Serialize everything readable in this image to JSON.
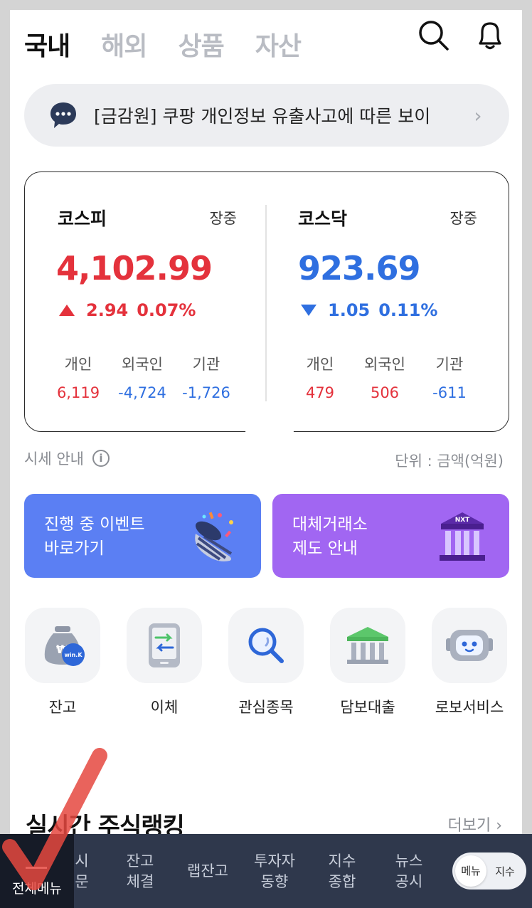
{
  "top_tabs": [
    {
      "label": "국내",
      "active": true
    },
    {
      "label": "해외",
      "active": false
    },
    {
      "label": "상품",
      "active": false
    },
    {
      "label": "자산",
      "active": false
    }
  ],
  "icons": {
    "search": "search-icon",
    "bell": "bell-icon"
  },
  "notice": {
    "text": "[금감원] 쿠팡 개인정보 유출사고에 따른 보이",
    "chevron": "›"
  },
  "indices": {
    "kospi": {
      "name": "코스피",
      "status": "장중",
      "value": "4,102.99",
      "change": "2.94",
      "change_pct": "0.07%",
      "direction": "up",
      "investors": [
        {
          "label": "개인",
          "value": "6,119",
          "sign": "up"
        },
        {
          "label": "외국인",
          "value": "-4,724",
          "sign": "down"
        },
        {
          "label": "기관",
          "value": "-1,726",
          "sign": "down"
        }
      ]
    },
    "kosdaq": {
      "name": "코스닥",
      "status": "장중",
      "value": "923.69",
      "change": "1.05",
      "change_pct": "0.11%",
      "direction": "down",
      "investors": [
        {
          "label": "개인",
          "value": "479",
          "sign": "up"
        },
        {
          "label": "외국인",
          "value": "506",
          "sign": "up"
        },
        {
          "label": "기관",
          "value": "-611",
          "sign": "down"
        }
      ]
    }
  },
  "sise_info": {
    "label": "시세 안내",
    "icon": "i"
  },
  "unit_label": "단위 : 금액(억원)",
  "banners": {
    "event": {
      "line1": "진행 중 이벤트",
      "line2": "바로가기",
      "color": "#5b7ff3"
    },
    "nxt": {
      "line1": "대체거래소",
      "line2": "제도 안내",
      "badge": "NXT",
      "color": "#a166f2"
    }
  },
  "quick_menu": [
    {
      "label": "잔고",
      "icon": "money-bag-icon",
      "badge": "win.K"
    },
    {
      "label": "이체",
      "icon": "transfer-phone-icon"
    },
    {
      "label": "관심종목",
      "icon": "magnifier-icon"
    },
    {
      "label": "담보대출",
      "icon": "bank-icon"
    },
    {
      "label": "로보서비스",
      "icon": "robot-icon"
    }
  ],
  "ranking": {
    "title": "실시간 주식랭킹",
    "more": "더보기 ›"
  },
  "bottom_nav": {
    "all_menu": "전체메뉴",
    "items": [
      {
        "line1": "시",
        "line2": "문"
      },
      {
        "line1": "잔고",
        "line2": "체결"
      },
      {
        "line1": "랩잔고",
        "line2": ""
      },
      {
        "line1": "투자자",
        "line2": "동향"
      },
      {
        "line1": "지수",
        "line2": "종합"
      },
      {
        "line1": "뉴스",
        "line2": "공시"
      }
    ],
    "toggle": {
      "on": "메뉴",
      "off": "지수"
    }
  },
  "colors": {
    "up": "#e4323c",
    "down": "#2f6fe0",
    "bottom_bar": "#2f384c"
  }
}
